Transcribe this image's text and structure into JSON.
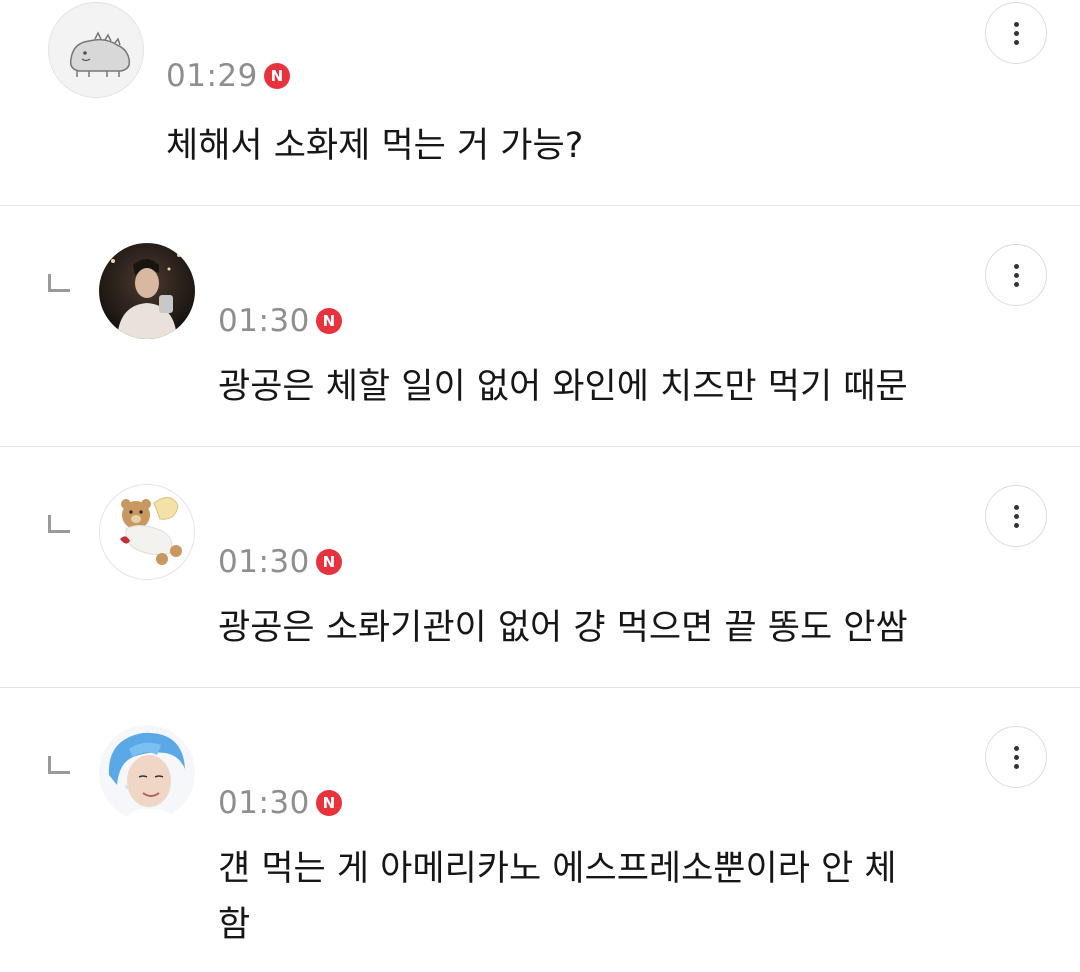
{
  "comments": [
    {
      "time": "01:29",
      "badge": "N",
      "text": "체해서 소화제 먹는 거 가능?",
      "avatar_icon": "dinosaur-cartoon-icon",
      "is_reply": false
    },
    {
      "time": "01:30",
      "badge": "N",
      "text": "광공은 체할 일이 없어 와인에 치즈만 먹기 때문",
      "avatar_icon": "person-photo-avatar",
      "is_reply": true
    },
    {
      "time": "01:30",
      "badge": "N",
      "text": "광공은 소롸기관이 없어 걍 먹으면 끝 똥도 안쌈",
      "avatar_icon": "teddy-bear-angel-avatar",
      "is_reply": true
    },
    {
      "time": "01:30",
      "badge": "N",
      "text": "걘 먹는 게 아메리카노 에스프레소뿐이라 안 체함",
      "avatar_icon": "blue-hair-person-avatar",
      "is_reply": true
    }
  ],
  "colors": {
    "badge_red": "#e8333e",
    "time_gray": "#8e8e8e",
    "divider": "#e4e4e4"
  }
}
